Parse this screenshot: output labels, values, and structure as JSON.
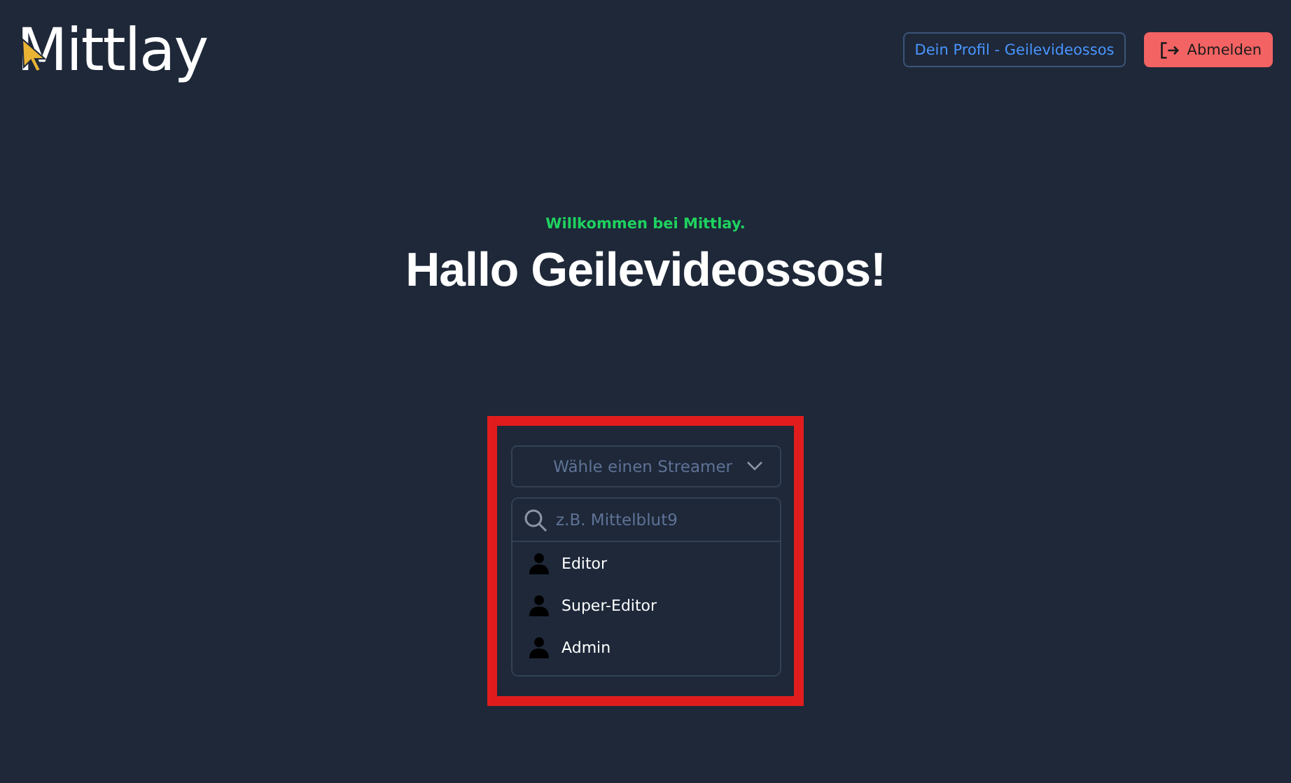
{
  "logo": {
    "text": "Mittlay"
  },
  "header": {
    "profile_button": "Dein Profil - Geilevideossos",
    "logout_button": "Abmelden"
  },
  "welcome": {
    "subtitle": "Willkommen bei Mittlay.",
    "title": "Hallo Geilevideossos!"
  },
  "streamer_select": {
    "placeholder": "Wähle einen Streamer",
    "search_placeholder": "z.B. Mittelblut9",
    "options": [
      {
        "label": "Editor"
      },
      {
        "label": "Super-Editor"
      },
      {
        "label": "Admin"
      }
    ]
  }
}
